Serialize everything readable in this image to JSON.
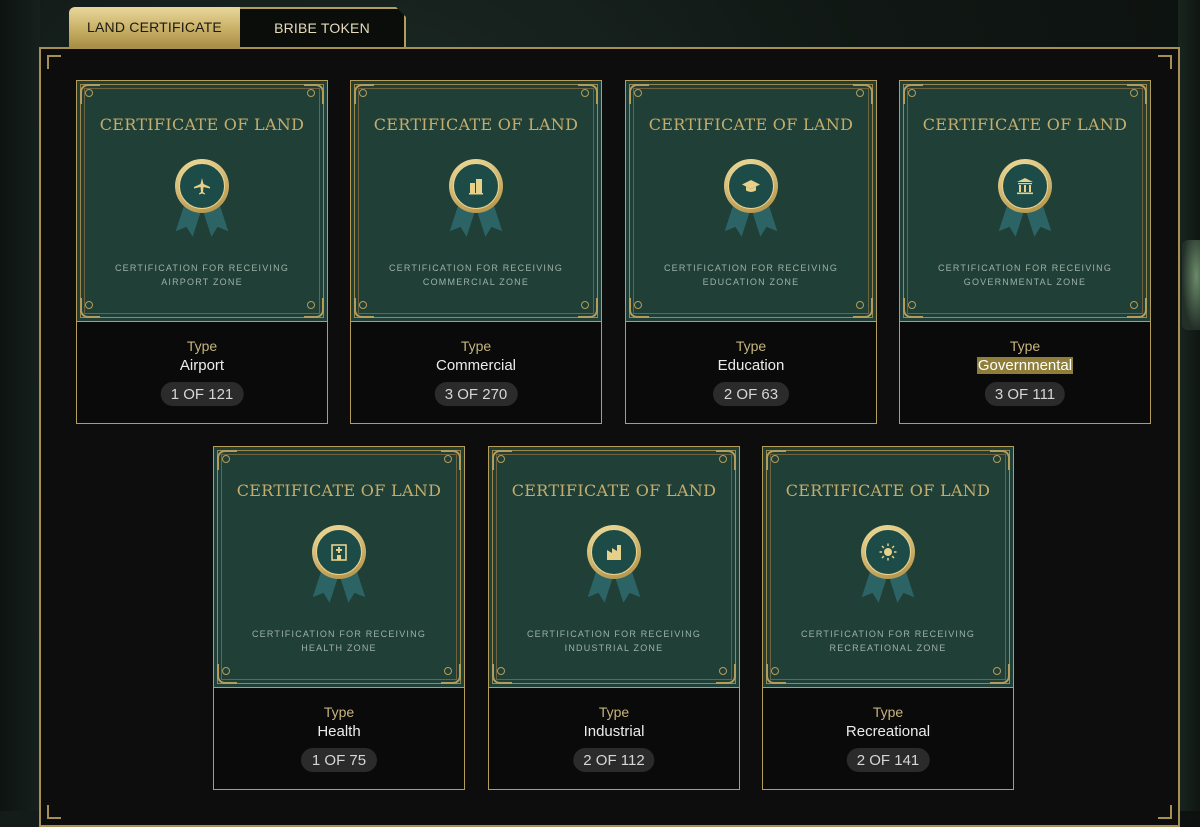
{
  "tabs": [
    {
      "label": "LAND CERTIFICATE",
      "active": true
    },
    {
      "label": "BRIBE TOKEN",
      "active": false
    }
  ],
  "colors": {
    "gold": "#b49d5c",
    "cert_green": "#1f3f37",
    "highlight": "#8f7d3a"
  },
  "cards": [
    {
      "title": "CERTIFICATE OF LAND",
      "icon": "airplane-icon",
      "sub_line1": "CERTIFICATION FOR RECEIVING",
      "sub_line2": "AIRPORT ZONE",
      "type_label": "Type",
      "type_value": "Airport",
      "count": "1 OF 121"
    },
    {
      "title": "CERTIFICATE OF LAND",
      "icon": "buildings-icon",
      "sub_line1": "CERTIFICATION FOR RECEIVING",
      "sub_line2": "COMMERCIAL ZONE",
      "type_label": "Type",
      "type_value": "Commercial",
      "count": "3 OF 270"
    },
    {
      "title": "CERTIFICATE OF LAND",
      "icon": "graduation-cap-icon",
      "sub_line1": "CERTIFICATION FOR RECEIVING",
      "sub_line2": "EDUCATION ZONE",
      "type_label": "Type",
      "type_value": "Education",
      "count": "2 OF 63"
    },
    {
      "title": "CERTIFICATE OF LAND",
      "icon": "government-building-icon",
      "sub_line1": "CERTIFICATION FOR RECEIVING",
      "sub_line2": "GOVERNMENTAL ZONE",
      "type_label": "Type",
      "type_value": "Governmental",
      "count": "3 OF 111",
      "highlighted": true
    },
    {
      "title": "CERTIFICATE OF LAND",
      "icon": "hospital-icon",
      "sub_line1": "CERTIFICATION FOR RECEIVING",
      "sub_line2": "HEALTH ZONE",
      "type_label": "Type",
      "type_value": "Health",
      "count": "1 OF 75"
    },
    {
      "title": "CERTIFICATE OF LAND",
      "icon": "factory-icon",
      "sub_line1": "CERTIFICATION FOR RECEIVING",
      "sub_line2": "INDUSTRIAL ZONE",
      "type_label": "Type",
      "type_value": "Industrial",
      "count": "2 OF 112"
    },
    {
      "title": "CERTIFICATE OF LAND",
      "icon": "sun-icon",
      "sub_line1": "CERTIFICATION FOR RECEIVING",
      "sub_line2": "RECREATIONAL ZONE",
      "type_label": "Type",
      "type_value": "Recreational",
      "count": "2 OF 141"
    }
  ]
}
